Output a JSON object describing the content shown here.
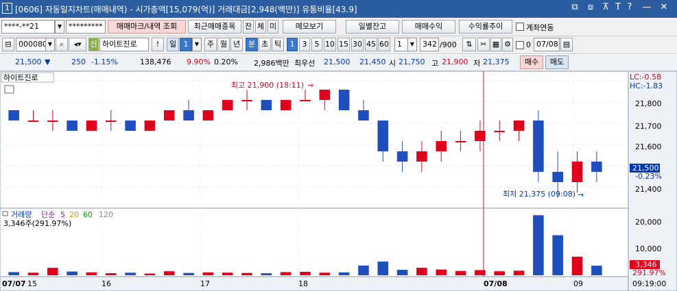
{
  "window": {
    "index": "1",
    "title": "[0606] 자동일지차트(매매내역) - 시가총액[15,079(억)] 거래대금[2,948(백만)] 유통비율[43.9]"
  },
  "title_controls": [
    "⧉",
    "⧈",
    "⊼",
    "T",
    "?",
    "—",
    "✕"
  ],
  "toolbar1": {
    "account": "****-**21",
    "password": "*********",
    "buttons": [
      "매매마크/내역 조회",
      "최근매매종목",
      "잔",
      "체",
      "미",
      "메모보기",
      "일별잔고",
      "매매수익",
      "수익률추이"
    ],
    "checkbox_label": "계좌연동"
  },
  "toolbar2": {
    "code": "000080",
    "badge": "신",
    "stock_name": "하이트진로",
    "excl": "!",
    "period": [
      "일",
      "1",
      "주",
      "월",
      "년",
      "분",
      "초",
      "틱"
    ],
    "minutes": [
      "1",
      "3",
      "5",
      "10",
      "15",
      "30",
      "45",
      "60"
    ],
    "count_sel": "1",
    "bars_shown": "342",
    "bars_total": "/900",
    "zero_label": "0",
    "date": "07/08"
  },
  "quote": {
    "price": "21,500",
    "arrow": "▼",
    "change": "250",
    "pct": "-1.15%",
    "volume": "138,476",
    "vol_ratio": "9.90%",
    "ratio2": "0.20%",
    "amount": "2,986백만",
    "best_label": "최우선",
    "best_ask": "21,500",
    "best_bid": "21,450",
    "open_label": "시",
    "open": "21,750",
    "high_label": "고",
    "high": "21,900",
    "low_label": "저",
    "low": "21,375",
    "buy": "매수",
    "sell": "매도"
  },
  "price_pane": {
    "name": "하이트진로",
    "high_annot": "최고 21,900 (18:11)",
    "low_annot": "최저 21,375 (09:08)",
    "lc": "LC:-0.58",
    "hc": "HC:-1.83",
    "axis": [
      "21,800",
      "21,700",
      "21,600",
      "21,500",
      "21,400"
    ],
    "current": "21,500",
    "current_pct": "-0.23%"
  },
  "volume_pane": {
    "label": "거래량",
    "ma_label": "단순",
    "mas": [
      "5",
      "20",
      "60",
      "120"
    ],
    "ma_colors": [
      "#c000c0",
      "#c8a000",
      "#00a000",
      "#8c8c8c"
    ],
    "value": "3,346주(291.97%)",
    "axis": [
      "20,000",
      "10,000"
    ],
    "current": "3,346",
    "current_pct": "291.97%"
  },
  "x_axis": {
    "labels": [
      "07/07",
      "15",
      "16",
      "17",
      "18",
      "07/08",
      "09"
    ],
    "time": "09:19:00"
  },
  "chart_data": {
    "type": "candlestick",
    "xlabels": [
      "07/07",
      "15",
      "16",
      "17",
      "18",
      "07/08",
      "09"
    ],
    "price_ylim": [
      21350,
      21950
    ],
    "vol_ylim": [
      0,
      23000
    ],
    "ohlc": [
      [
        21800,
        21800,
        21750,
        21750
      ],
      [
        21750,
        21800,
        21750,
        21750
      ],
      [
        21750,
        21800,
        21700,
        21750
      ],
      [
        21750,
        21750,
        21700,
        21700
      ],
      [
        21700,
        21750,
        21700,
        21750
      ],
      [
        21750,
        21800,
        21700,
        21750
      ],
      [
        21750,
        21750,
        21700,
        21700
      ],
      [
        21700,
        21750,
        21700,
        21750
      ],
      [
        21750,
        21800,
        21750,
        21800
      ],
      [
        21800,
        21850,
        21750,
        21750
      ],
      [
        21750,
        21800,
        21750,
        21800
      ],
      [
        21800,
        21850,
        21800,
        21850
      ],
      [
        21850,
        21900,
        21800,
        21850
      ],
      [
        21850,
        21850,
        21800,
        21800
      ],
      [
        21800,
        21850,
        21800,
        21850
      ],
      [
        21850,
        21900,
        21850,
        21850
      ],
      [
        21850,
        21900,
        21800,
        21900
      ],
      [
        21900,
        21900,
        21800,
        21800
      ],
      [
        21800,
        21850,
        21750,
        21750
      ],
      [
        21750,
        21750,
        21550,
        21600
      ],
      [
        21600,
        21650,
        21500,
        21550
      ],
      [
        21550,
        21650,
        21500,
        21600
      ],
      [
        21600,
        21700,
        21550,
        21650
      ],
      [
        21650,
        21700,
        21600,
        21650
      ],
      [
        21650,
        21750,
        21600,
        21700
      ],
      [
        21700,
        21750,
        21650,
        21700
      ],
      [
        21700,
        21750,
        21650,
        21750
      ],
      [
        21750,
        21800,
        21450,
        21500
      ],
      [
        21500,
        21600,
        21375,
        21450
      ],
      [
        21450,
        21600,
        21400,
        21550
      ],
      [
        21550,
        21600,
        21450,
        21500
      ]
    ],
    "volume": [
      1100,
      900,
      2600,
      1300,
      1000,
      700,
      900,
      600,
      1400,
      800,
      1000,
      900,
      800,
      700,
      1100,
      1200,
      900,
      1000,
      3400,
      4800,
      1900,
      2600,
      2000,
      1500,
      1800,
      1400,
      1600,
      21000,
      14000,
      6500,
      3346
    ]
  }
}
